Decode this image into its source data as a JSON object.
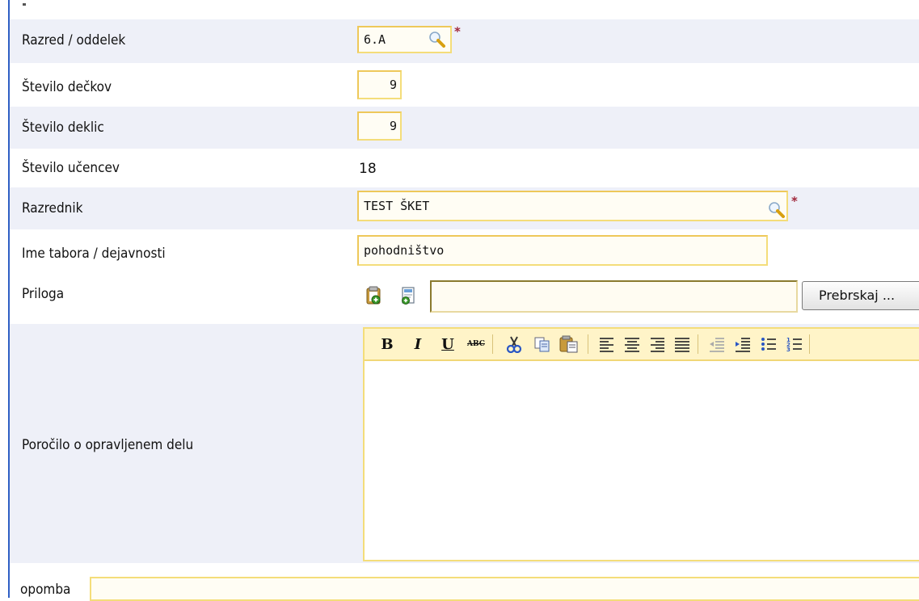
{
  "rows": [
    {
      "label": "Razred / oddelek",
      "value": "6.A",
      "required": "*"
    },
    {
      "label": "Število dečkov",
      "value": "9"
    },
    {
      "label": "Število deklic",
      "value": "9"
    },
    {
      "label": "Število učencev",
      "value": "18"
    },
    {
      "label": "Razrednik",
      "value": "TEST ŠKET",
      "required": "*"
    },
    {
      "label": "Ime tabora / dejavnosti",
      "value": "pohodništvo"
    },
    {
      "label": "Priloga",
      "file_value": "",
      "browse_label": "Prebrskaj ..."
    },
    {
      "label": "Poročilo o opravljenem delu",
      "body": ""
    },
    {
      "label": "opomba",
      "value": ""
    }
  ],
  "editor_toolbar": {
    "bold": "B",
    "italic": "I",
    "underline": "U",
    "strike": "ABC"
  },
  "colors": {
    "row_shade": "#eef0f8",
    "field_border": "#f4dd7a",
    "toolbar_bg": "#fff4c8",
    "required_star": "#a0283c",
    "left_rule": "#2f5fc4"
  }
}
